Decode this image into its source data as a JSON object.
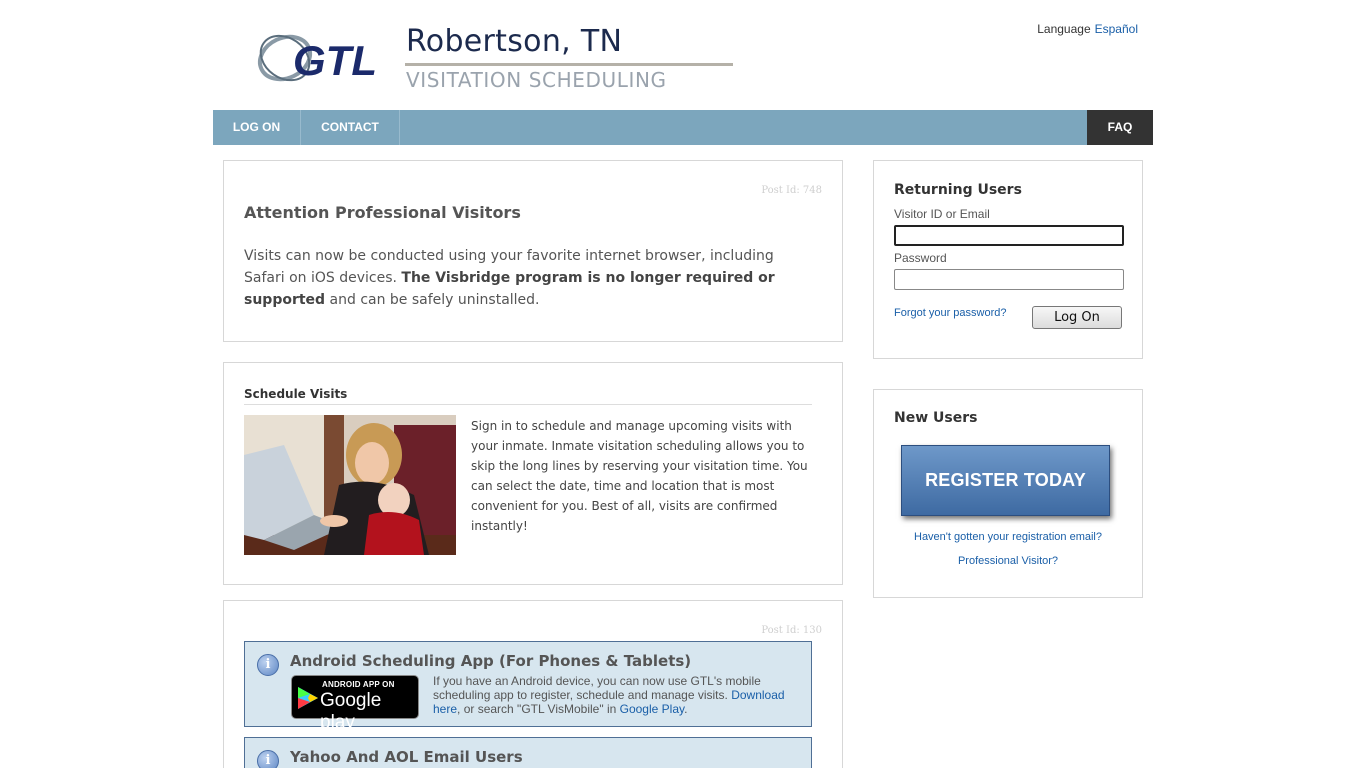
{
  "header": {
    "title": "Robertson, TN",
    "subtitle": "VISITATION SCHEDULING",
    "logo_text": "GTL",
    "language_label": "Language",
    "language_link": "Español"
  },
  "nav": {
    "items": [
      {
        "label": "LOG ON"
      },
      {
        "label": "CONTACT"
      }
    ],
    "faq": "FAQ"
  },
  "posts": {
    "attention": {
      "post_id": "Post Id: 748",
      "title": "Attention Professional Visitors",
      "text_1": "Visits can now be conducted using your favorite internet browser, including Safari on iOS devices. ",
      "text_bold": "The Visbridge program is no longer required or supported",
      "text_2": " and can be safely uninstalled."
    },
    "schedule": {
      "title": "Schedule Visits",
      "text": "Sign in to schedule and manage upcoming visits with your inmate. Inmate visitation scheduling allows you to skip the long lines by reserving your visitation time. You can select the date, time and location that is most convenient for you. Best of all, visits are confirmed instantly!"
    },
    "apps": {
      "post_id": "Post Id: 130",
      "android_title": "Android Scheduling App (For Phones & Tablets)",
      "badge_small": "ANDROID APP ON",
      "badge_big": "Google play",
      "android_text_1": "If you have an Android device, you can now use GTL's mobile scheduling app to register, schedule and manage visits. ",
      "android_link_1": "Download here",
      "android_text_2": ", or search \"GTL VisMobile\" in ",
      "android_link_2": "Google Play",
      "android_text_3": ".",
      "yahoo_title": "Yahoo And AOL Email Users"
    }
  },
  "returning": {
    "title": "Returning Users",
    "id_label": "Visitor ID or Email",
    "id_value": "",
    "password_label": "Password",
    "password_value": "",
    "forgot": "Forgot your password?",
    "logon": "Log On"
  },
  "new_users": {
    "title": "New Users",
    "register": "REGISTER TODAY",
    "resend": "Haven't gotten your registration email?",
    "professional": "Professional Visitor?"
  },
  "colors": {
    "nav": "#7ca6bd",
    "faq": "#333333",
    "link": "#1a5fa8",
    "register": "#4f7bb3",
    "info_box": "#d7e6ef"
  }
}
